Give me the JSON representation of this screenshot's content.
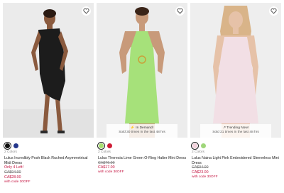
{
  "products": [
    {
      "colors_label": "2 Colors",
      "name": "Lulus Incredibly Posh Black Ruched Asymmetrical Midi Dress",
      "stock_note": "Only 4 Left!",
      "was_price": "CA$94.00",
      "now_price": "CA$28.00",
      "promo": "with code 30OFF",
      "badge": null,
      "swatches": [
        "#111111",
        "#24378c"
      ],
      "selected_swatch": 0,
      "dress_color": "#1c1c1c",
      "bg_color": "#ebebeb"
    },
    {
      "colors_label": "2 Colors",
      "name": "Lulus Theresia Lime Green O-Ring Halter Mini Dress",
      "stock_note": "",
      "was_price": "CA$76.00",
      "now_price": "CA$17.00",
      "promo": "with code 30OFF",
      "badge": {
        "line1": "In Demand!",
        "line2": "Sold 30 times in the last 48 hrs",
        "icon": "lightning-icon"
      },
      "swatches": [
        "#a8df70",
        "#cf1c36"
      ],
      "selected_swatch": 0,
      "dress_color": "#a6e17a",
      "bg_color": "#ececec"
    },
    {
      "colors_label": "2 Colors",
      "name": "Lulus Naina Light Pink Embroidered Sleeveless Mini Dress",
      "stock_note": "",
      "was_price": "CA$94.00",
      "now_price": "CA$23.00",
      "promo": "with code 30OFF",
      "badge": {
        "line1": "Trending Now!",
        "line2": "Sold 21 times in the last 48 hrs",
        "icon": "trending-icon"
      },
      "swatches": [
        "#f3d2dc",
        "#9fd67a"
      ],
      "selected_swatch": 0,
      "dress_color": "#f2dfe5",
      "bg_color": "#eeeeee"
    }
  ]
}
